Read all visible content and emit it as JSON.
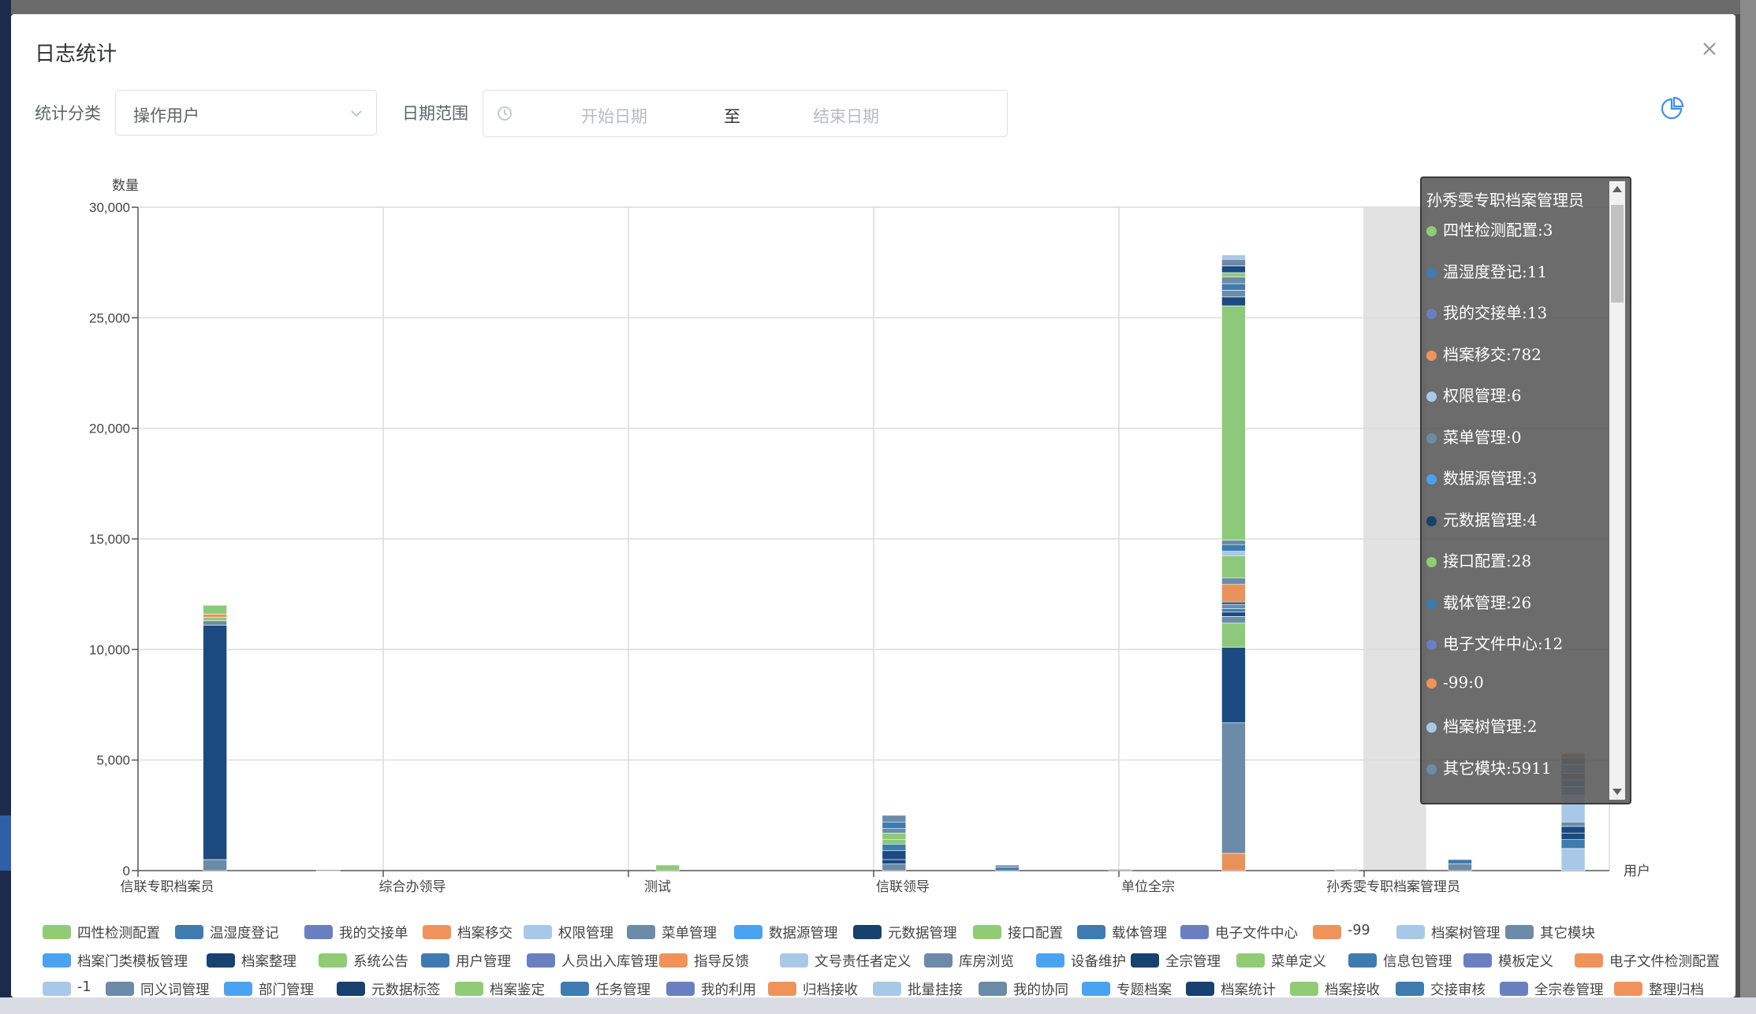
{
  "dialog": {
    "title": "日志统计",
    "close_icon": "close-icon"
  },
  "filters": {
    "category_label": "统计分类",
    "category_value": "操作用户",
    "date_label": "日期范围",
    "start_placeholder": "开始日期",
    "separator": "至",
    "end_placeholder": "结束日期",
    "clock_icon": "clock-icon",
    "chart_toggle_icon": "pie-chart-icon"
  },
  "chart_data": {
    "type": "bar",
    "stacked": true,
    "ylabel": "数量",
    "xlabel": "用户",
    "ylim": [
      0,
      30000
    ],
    "yticks": [
      "0",
      "5,000",
      "10,000",
      "15,000",
      "20,000",
      "25,000",
      "30,000"
    ],
    "grid": true,
    "categories": [
      "信联专职档案员",
      "综合办领导",
      "测试",
      "信联领导",
      "单位全宗",
      "孙秀雯专职档案管理员"
    ],
    "highlighted_category": "孙秀雯专职档案管理员",
    "bars": [
      {
        "segments": [
          [
            500,
            "#6b8ba8"
          ],
          [
            10600,
            "#1a4a80"
          ],
          [
            200,
            "#6b8ba8"
          ],
          [
            150,
            "#8dc97a"
          ],
          [
            150,
            "#e8925a"
          ],
          [
            400,
            "#8dc97a"
          ]
        ]
      },
      {
        "segments": [
          [
            40,
            "#999999"
          ]
        ]
      },
      {
        "segments": []
      },
      {
        "segments": []
      },
      {
        "segments": [
          [
            250,
            "#8dc97a"
          ]
        ]
      },
      {
        "segments": []
      },
      {
        "segments": [
          [
            300,
            "#6b8ba8"
          ],
          [
            200,
            "#1a4a80"
          ],
          [
            400,
            "#1a4a80"
          ],
          [
            300,
            "#3e7bb0"
          ],
          [
            200,
            "#8dc97a"
          ],
          [
            300,
            "#8dc97a"
          ],
          [
            200,
            "#6b8ba8"
          ],
          [
            300,
            "#3e7bb0"
          ],
          [
            300,
            "#6b8ba8"
          ]
        ]
      },
      {
        "segments": [
          [
            150,
            "#3e7bb0"
          ],
          [
            100,
            "#6b8ba8"
          ]
        ]
      },
      {
        "segments": [
          [
            60,
            "#999999"
          ]
        ]
      },
      {
        "segments": [
          [
            782,
            "#e8925a"
          ],
          [
            5911,
            "#6b8ba8"
          ],
          [
            3400,
            "#1a4a80"
          ],
          [
            1100,
            "#8dc97a"
          ],
          [
            300,
            "#6b8ba8"
          ],
          [
            200,
            "#1a4a80"
          ],
          [
            150,
            "#3e7bb0"
          ],
          [
            200,
            "#6b8ba8"
          ],
          [
            100,
            "#1a4a80"
          ],
          [
            800,
            "#e8925a"
          ],
          [
            300,
            "#6b8ba8"
          ],
          [
            1000,
            "#8dc97a"
          ],
          [
            200,
            "#a8c8e8"
          ],
          [
            300,
            "#3e7bb0"
          ],
          [
            200,
            "#6b8ba8"
          ],
          [
            10600,
            "#8dc97a"
          ],
          [
            400,
            "#1a4a80"
          ],
          [
            300,
            "#6b8ba8"
          ],
          [
            300,
            "#3e7bb0"
          ],
          [
            300,
            "#6b8ba8"
          ],
          [
            200,
            "#8dc97a"
          ],
          [
            300,
            "#1a4a80"
          ],
          [
            300,
            "#6b8ba8"
          ],
          [
            200,
            "#a8c8e8"
          ]
        ]
      },
      {
        "segments": [
          [
            60,
            "#999999"
          ]
        ]
      },
      {
        "segments": [
          [
            300,
            "#6b8ba8"
          ],
          [
            200,
            "#3e7bb0"
          ]
        ]
      },
      {
        "segments": [
          [
            1000,
            "#a8c8e8"
          ],
          [
            400,
            "#3e7bb0"
          ],
          [
            300,
            "#1a4a80"
          ],
          [
            300,
            "#1a4a80"
          ],
          [
            200,
            "#6b8ba8"
          ],
          [
            1200,
            "#a8c8e8"
          ],
          [
            400,
            "#6b8ba8"
          ],
          [
            300,
            "#3e7bb0"
          ],
          [
            300,
            "#5d6b8a"
          ],
          [
            400,
            "#6b8ba8"
          ],
          [
            300,
            "#5a7080"
          ],
          [
            200,
            "#d58555"
          ]
        ]
      }
    ]
  },
  "tooltip": {
    "title": "孙秀雯专职档案管理员",
    "items": [
      {
        "label": "四性检测配置:3",
        "color": "#91cc75"
      },
      {
        "label": "温湿度登记:11",
        "color": "#3e7bb0"
      },
      {
        "label": "我的交接单:13",
        "color": "#6a7fc0"
      },
      {
        "label": "档案移交:782",
        "color": "#f0935a"
      },
      {
        "label": "权限管理:6",
        "color": "#a8c8e8"
      },
      {
        "label": "菜单管理:0",
        "color": "#6b8ba8"
      },
      {
        "label": "数据源管理:3",
        "color": "#4aa3f0"
      },
      {
        "label": "元数据管理:4",
        "color": "#17416e"
      },
      {
        "label": "接口配置:28",
        "color": "#91cc75"
      },
      {
        "label": "载体管理:26",
        "color": "#3e7bb0"
      },
      {
        "label": "电子文件中心:12",
        "color": "#6a7fc0"
      },
      {
        "label": "-99:0",
        "color": "#f0935a"
      },
      {
        "label": "档案树管理:2",
        "color": "#a8c8e8"
      },
      {
        "label": "其它模块:5911",
        "color": "#6b8ba8"
      }
    ]
  },
  "legend": {
    "rows": [
      [
        {
          "label": "四性检测配置",
          "color": "#91cc75"
        },
        {
          "label": "温湿度登记",
          "color": "#3e7bb0"
        },
        {
          "label": "我的交接单",
          "color": "#6a7fc0"
        },
        {
          "label": "档案移交",
          "color": "#f0935a"
        },
        {
          "label": "权限管理",
          "color": "#a8c8e8"
        },
        {
          "label": "菜单管理",
          "color": "#6b8ba8"
        },
        {
          "label": "数据源管理",
          "color": "#4aa3f0"
        },
        {
          "label": "元数据管理",
          "color": "#17416e"
        },
        {
          "label": "接口配置",
          "color": "#91cc75"
        },
        {
          "label": "载体管理",
          "color": "#3e7bb0"
        },
        {
          "label": "电子文件中心",
          "color": "#6a7fc0"
        },
        {
          "label": "-99",
          "color": "#f0935a"
        },
        {
          "label": "档案树管理",
          "color": "#a8c8e8"
        },
        {
          "label": "其它模块",
          "color": "#6b8ba8"
        }
      ],
      [
        {
          "label": "档案门类模板管理",
          "color": "#4aa3f0"
        },
        {
          "label": "档案整理",
          "color": "#17416e"
        },
        {
          "label": "系统公告",
          "color": "#91cc75"
        },
        {
          "label": "用户管理",
          "color": "#3e7bb0"
        },
        {
          "label": "人员出入库管理",
          "color": "#6a7fc0"
        },
        {
          "label": "指导反馈",
          "color": "#f0935a"
        },
        {
          "label": "文号责任者定义",
          "color": "#a8c8e8"
        },
        {
          "label": "库房浏览",
          "color": "#6b8ba8"
        },
        {
          "label": "设备维护",
          "color": "#4aa3f0"
        },
        {
          "label": "全宗管理",
          "color": "#17416e"
        },
        {
          "label": "菜单定义",
          "color": "#91cc75"
        },
        {
          "label": "信息包管理",
          "color": "#3e7bb0"
        },
        {
          "label": "模板定义",
          "color": "#6a7fc0"
        },
        {
          "label": "电子文件检测配置",
          "color": "#f0935a"
        }
      ],
      [
        {
          "label": "-1",
          "color": "#a8c8e8"
        },
        {
          "label": "同义词管理",
          "color": "#6b8ba8"
        },
        {
          "label": "部门管理",
          "color": "#4aa3f0"
        },
        {
          "label": "元数据标签",
          "color": "#17416e"
        },
        {
          "label": "档案鉴定",
          "color": "#91cc75"
        },
        {
          "label": "任务管理",
          "color": "#3e7bb0"
        },
        {
          "label": "我的利用",
          "color": "#6a7fc0"
        },
        {
          "label": "归档接收",
          "color": "#f0935a"
        },
        {
          "label": "批量挂接",
          "color": "#a8c8e8"
        },
        {
          "label": "我的协同",
          "color": "#6b8ba8"
        },
        {
          "label": "专题档案",
          "color": "#4aa3f0"
        },
        {
          "label": "档案统计",
          "color": "#17416e"
        },
        {
          "label": "档案接收",
          "color": "#91cc75"
        },
        {
          "label": "交接审核",
          "color": "#3e7bb0"
        },
        {
          "label": "全宗卷管理",
          "color": "#6a7fc0"
        },
        {
          "label": "整理归档",
          "color": "#f0935a"
        }
      ]
    ]
  }
}
